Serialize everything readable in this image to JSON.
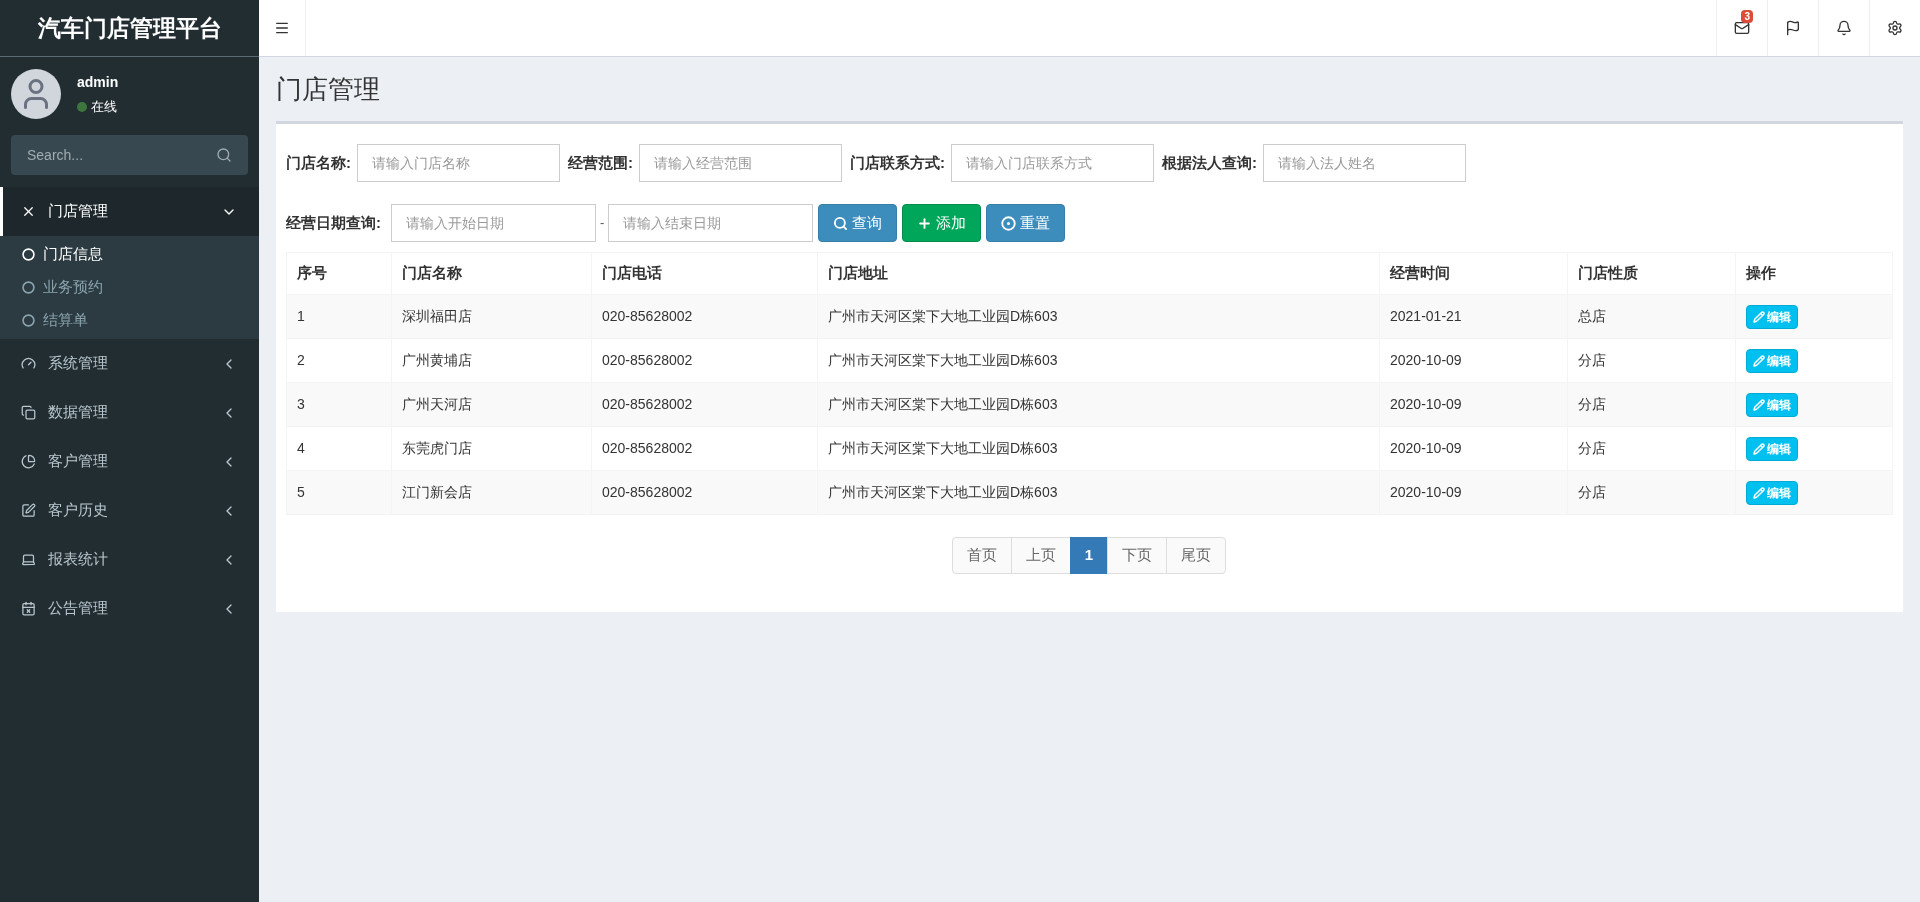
{
  "brand": "汽车门店管理平台",
  "header": {
    "mail_badge": "3"
  },
  "user": {
    "name": "admin",
    "status": "在线",
    "online": true
  },
  "sidebar_search": {
    "placeholder": "Search..."
  },
  "menu": [
    {
      "label": "门店管理",
      "expanded": true,
      "selected": true,
      "children": [
        {
          "label": "门店信息",
          "selected": true
        },
        {
          "label": "业务预约",
          "selected": false
        },
        {
          "label": "结算单",
          "selected": false
        }
      ]
    },
    {
      "label": "系统管理",
      "expanded": false,
      "selected": false
    },
    {
      "label": "数据管理",
      "expanded": false,
      "selected": false
    },
    {
      "label": "客户管理",
      "expanded": false,
      "selected": false
    },
    {
      "label": "客户历史",
      "expanded": false,
      "selected": false
    },
    {
      "label": "报表统计",
      "expanded": false,
      "selected": false
    },
    {
      "label": "公告管理",
      "expanded": false,
      "selected": false
    }
  ],
  "page_title": "门店管理",
  "filters": [
    {
      "label": "门店名称:",
      "placeholder": "请输入门店名称"
    },
    {
      "label": "经营范围:",
      "placeholder": "请输入经营范围"
    },
    {
      "label": "门店联系方式:",
      "placeholder": "请输入门店联系方式"
    },
    {
      "label": "根据法人查询:",
      "placeholder": "请输入法人姓名"
    }
  ],
  "date_filter": {
    "label": "经营日期查询:",
    "start_placeholder": "请输入开始日期",
    "separator": "-",
    "end_placeholder": "请输入结束日期"
  },
  "buttons": [
    {
      "kind": "search",
      "label": "查询"
    },
    {
      "kind": "add",
      "label": "添加"
    },
    {
      "kind": "reset",
      "label": "重置"
    }
  ],
  "table": {
    "columns": [
      "序号",
      "门店名称",
      "门店电话",
      "门店地址",
      "经营时间",
      "门店性质",
      "操作"
    ],
    "rows": [
      {
        "cells": [
          "1",
          "深圳福田店",
          "020-85628002",
          "广州市天河区棠下大地工业园D栋603",
          "2021-01-21",
          "总店"
        ],
        "action": "编辑"
      },
      {
        "cells": [
          "2",
          "广州黄埔店",
          "020-85628002",
          "广州市天河区棠下大地工业园D栋603",
          "2020-10-09",
          "分店"
        ],
        "action": "编辑"
      },
      {
        "cells": [
          "3",
          "广州天河店",
          "020-85628002",
          "广州市天河区棠下大地工业园D栋603",
          "2020-10-09",
          "分店"
        ],
        "action": "编辑"
      },
      {
        "cells": [
          "4",
          "东莞虎门店",
          "020-85628002",
          "广州市天河区棠下大地工业园D栋603",
          "2020-10-09",
          "分店"
        ],
        "action": "编辑"
      },
      {
        "cells": [
          "5",
          "江门新会店",
          "020-85628002",
          "广州市天河区棠下大地工业园D栋603",
          "2020-10-09",
          "分店"
        ],
        "action": "编辑"
      }
    ]
  },
  "pagination": [
    {
      "label": "首页",
      "selected": false
    },
    {
      "label": "上页",
      "selected": false
    },
    {
      "label": "1",
      "selected": true
    },
    {
      "label": "下页",
      "selected": false
    },
    {
      "label": "尾页",
      "selected": false
    }
  ]
}
